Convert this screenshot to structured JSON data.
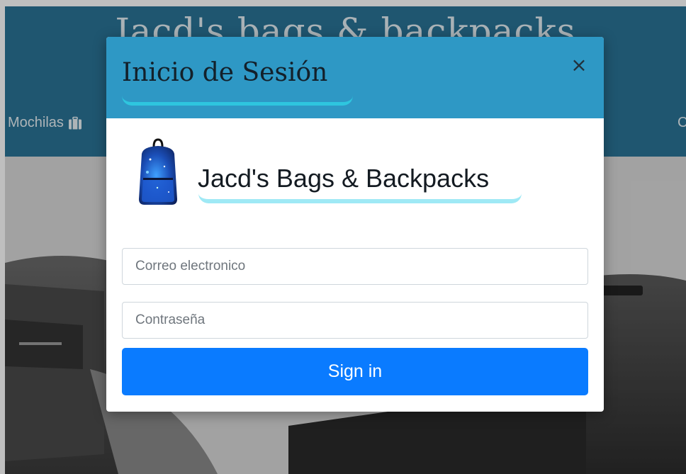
{
  "site": {
    "title": "Jacd's bags & backpacks",
    "nav_left_label": "Mochilas",
    "nav_right_label": "C",
    "header_color": "#2a7396"
  },
  "modal": {
    "title": "Inicio de Sesión",
    "close_label": "×",
    "brand_name": "Jacd's Bags & Backpacks",
    "email_placeholder": "Correo electronico",
    "email_value": "",
    "password_placeholder": "Contraseña",
    "password_value": "",
    "signin_label": "Sign in",
    "header_color": "#2e98c5",
    "accent_color": "#0a7bff",
    "logo_icon": "backpack-icon"
  }
}
